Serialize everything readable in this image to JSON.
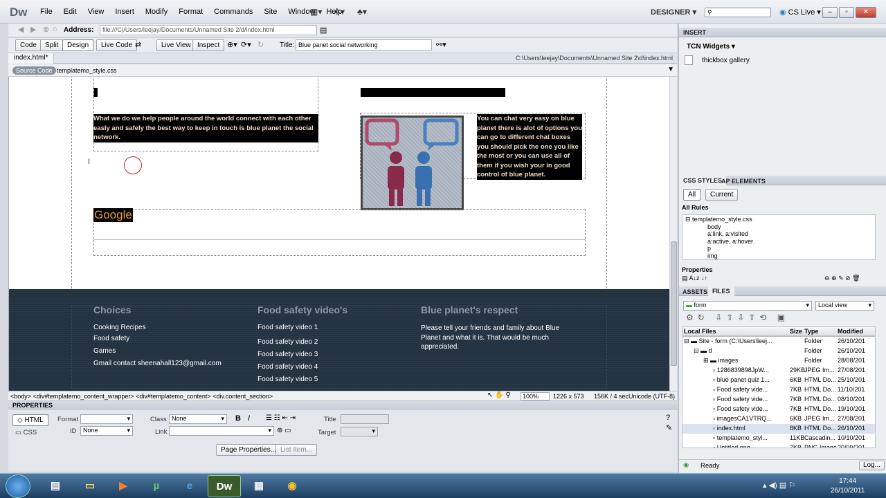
{
  "app": {
    "logo": "Dw",
    "workspace": "DESIGNER",
    "cslive": "CS Live"
  },
  "menu": [
    "File",
    "Edit",
    "View",
    "Insert",
    "Modify",
    "Format",
    "Commands",
    "Site",
    "Window",
    "Help"
  ],
  "address": {
    "label": "Address:",
    "value": "file:///C|/Users/leejay/Documents/Unnamed Site 2/d/index.html"
  },
  "toolbar": {
    "code": "Code",
    "split": "Split",
    "design": "Design",
    "live_code": "Live Code",
    "live_view": "Live View",
    "inspect": "Inspect",
    "title_label": "Title:",
    "title_value": "Blue panet social networking"
  },
  "tab": {
    "name": "index.html*",
    "path": "C:\\Users\\leejay\\Documents\\Unnamed Site 2\\d\\index.html",
    "source": "Source Code",
    "related": "templatemo_style.css"
  },
  "content": {
    "left_text": "What we do we help people around the world connect with each other easly and safely the best way to keep in touch is blue planet the social network.",
    "right_text": "You can chat very easy on blue planet there is alot of options you can go to different chat boxes you should pick the one you like the most or you can use all of them if you wish your in good control of blue planet.",
    "google": "Google"
  },
  "footer": {
    "col1": {
      "title": "Choices",
      "items": [
        "Cooking Recipes",
        "Food safety",
        "Games",
        "Gmail contact sheenahall123@gmail.com"
      ]
    },
    "col2": {
      "title": "Food safety video's",
      "items": [
        "Food safety video 1",
        "Food safety video 2",
        "Food safety video 3",
        "Food safety video 4",
        "Food safety video 5"
      ]
    },
    "col3": {
      "title": "Blue planet's respect",
      "text": "Please tell your friends and family about Blue Planet and what it is. That would be much appreciated."
    }
  },
  "status": {
    "tags": "<body> <div#templatemo_content_wrapper> <div#templatemo_content> <div.content_section>",
    "zoom": "100%",
    "size": "1226 x 573",
    "download": "156K / 4 sec",
    "encoding": "Unicode (UTF-8)"
  },
  "properties": {
    "header": "PROPERTIES",
    "html": "HTML",
    "css": "CSS",
    "format_label": "Format",
    "id_label": "ID",
    "id_value": "None",
    "class_label": "Class",
    "class_value": "None",
    "link_label": "Link",
    "title_label": "Title",
    "target_label": "Target",
    "page_props": "Page Properties...",
    "list_item": "List Item..."
  },
  "insert_panel": {
    "header": "INSERT",
    "category": "TCN Widgets",
    "item": "thickbox gallery"
  },
  "css_panel": {
    "tab1": "CSS STYLES",
    "tab2": "AP ELEMENTS",
    "all": "All",
    "current": "Current",
    "all_rules": "All Rules",
    "sheet": "templatemo_style.css",
    "rules": [
      "body",
      "a:link, a:visited",
      "a:active, a:hover",
      "p",
      "img"
    ],
    "properties": "Properties"
  },
  "files_panel": {
    "tab1": "ASSETS",
    "tab2": "FILES",
    "site": "form",
    "view": "Local view",
    "columns": [
      "Local Files",
      "Size",
      "Type",
      "Modified"
    ],
    "rows": [
      {
        "name": "Site - form (C:\\Users\\leej...",
        "size": "",
        "type": "Folder",
        "mod": "26/10/201"
      },
      {
        "name": "d",
        "size": "",
        "type": "Folder",
        "mod": "26/10/201"
      },
      {
        "name": "images",
        "size": "",
        "type": "Folder",
        "mod": "28/08/201"
      },
      {
        "name": "1286839898JpW...",
        "size": "29KB",
        "type": "JPEG Im...",
        "mod": "27/08/201"
      },
      {
        "name": "blue panet quiz 1...",
        "size": "6KB",
        "type": "HTML Do...",
        "mod": "25/10/201"
      },
      {
        "name": "Food safety vide...",
        "size": "7KB",
        "type": "HTML Do...",
        "mod": "11/10/201"
      },
      {
        "name": "Food safety vide...",
        "size": "7KB",
        "type": "HTML Do...",
        "mod": "08/10/201"
      },
      {
        "name": "Food safety vide...",
        "size": "7KB",
        "type": "HTML Do...",
        "mod": "19/10/201"
      },
      {
        "name": "imagesCA1VTRQ...",
        "size": "6KB",
        "type": "JPEG Im...",
        "mod": "27/08/201"
      },
      {
        "name": "index.html",
        "size": "8KB",
        "type": "HTML Do...",
        "mod": "26/10/201"
      },
      {
        "name": "templatemo_styl...",
        "size": "11KB",
        "type": "Cascadin...",
        "mod": "10/10/201"
      },
      {
        "name": "Untitled.png",
        "size": "7KB",
        "type": "PNG Image",
        "mod": "20/09/201"
      }
    ],
    "ready": "Ready",
    "log": "Log..."
  },
  "taskbar": {
    "time": "17:44",
    "date": "26/10/2011"
  }
}
